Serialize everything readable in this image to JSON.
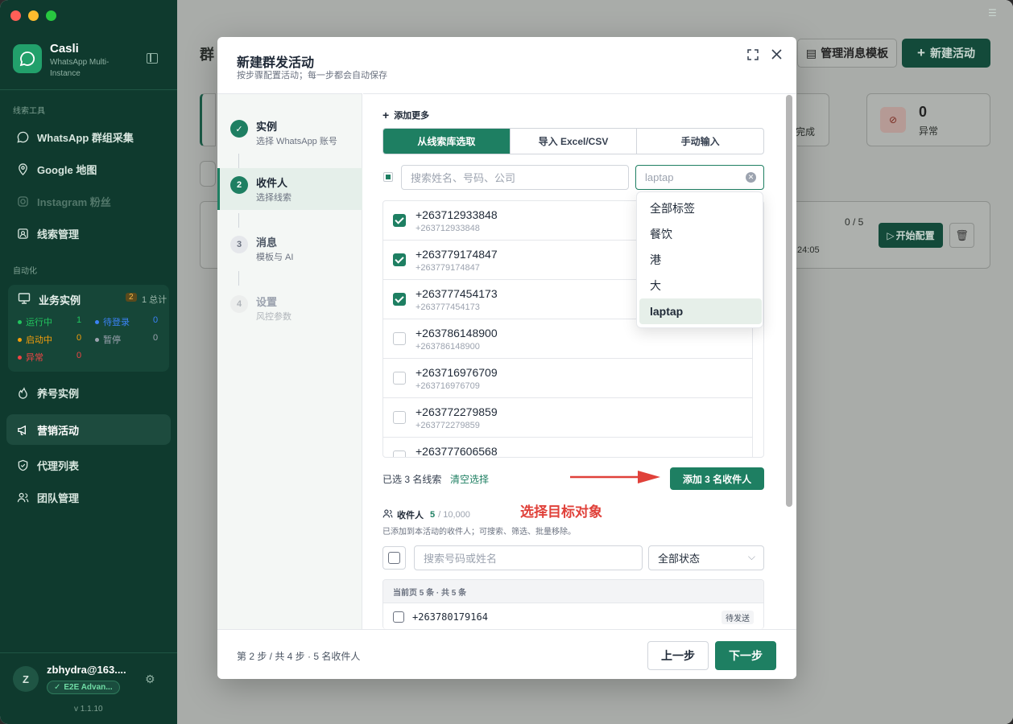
{
  "app": {
    "name": "Casli",
    "subtitle": "WhatsApp Multi-Instance",
    "version": "v 1.1.10"
  },
  "sidebar": {
    "section_tools": "线索工具",
    "section_auto": "自动化",
    "items": [
      {
        "label": "WhatsApp 群组采集",
        "icon": "chat-bubble-icon"
      },
      {
        "label": "Google 地图",
        "icon": "map-pin-icon"
      },
      {
        "label": "Instagram 粉丝",
        "icon": "instagram-icon"
      },
      {
        "label": "线索管理",
        "icon": "contact-card-icon"
      },
      {
        "label": "养号实例",
        "icon": "flame-icon"
      },
      {
        "label": "营销活动",
        "icon": "megaphone-icon"
      },
      {
        "label": "代理列表",
        "icon": "shield-icon"
      },
      {
        "label": "团队管理",
        "icon": "users-icon"
      }
    ],
    "business": {
      "title": "业务实例",
      "badge": "2",
      "total": "1 总计",
      "stats": [
        {
          "label": "运行中",
          "value": "1",
          "color": "#22c55e"
        },
        {
          "label": "待登录",
          "value": "0",
          "color": "#3b82f6"
        },
        {
          "label": "启动中",
          "value": "0",
          "color": "#f59e0b"
        },
        {
          "label": "暂停",
          "value": "0",
          "color": "#9ca3af"
        },
        {
          "label": "异常",
          "value": "0",
          "color": "#ef4444"
        }
      ]
    },
    "user": {
      "initial": "Z",
      "email": "zbhydra@163....",
      "plan": "E2E Advan..."
    }
  },
  "background": {
    "title_fragment": "群",
    "btn_templates": "管理消息模板",
    "btn_new": "新建活动",
    "stat_done": "完成",
    "stat_error_value": "0",
    "stat_error_label": "异常",
    "progress": "0 / 5",
    "time": ":24:05",
    "btn_start": "开始配置"
  },
  "modal": {
    "title": "新建群发活动",
    "subtitle": "按步骤配置活动；每一步都会自动保存",
    "steps": [
      {
        "num": "✓",
        "title": "实例",
        "sub": "选择 WhatsApp 账号"
      },
      {
        "num": "2",
        "title": "收件人",
        "sub": "选择线索"
      },
      {
        "num": "3",
        "title": "消息",
        "sub": "模板与 AI"
      },
      {
        "num": "4",
        "title": "设置",
        "sub": "风控参数"
      }
    ],
    "add_more": "添加更多",
    "tabs": [
      "从线索库选取",
      "导入 Excel/CSV",
      "手动输入"
    ],
    "search_placeholder": "搜索姓名、号码、公司",
    "tag_value": "laptap",
    "contacts": [
      {
        "phone": "+263712933848",
        "sub": "+263712933848",
        "checked": true
      },
      {
        "phone": "+263779174847",
        "sub": "+263779174847",
        "checked": true
      },
      {
        "phone": "+263777454173",
        "sub": "+263777454173",
        "checked": true
      },
      {
        "phone": "+263786148900",
        "sub": "+263786148900",
        "checked": false
      },
      {
        "phone": "+263716976709",
        "sub": "+263716976709",
        "checked": false
      },
      {
        "phone": "+263772279859",
        "sub": "+263772279859",
        "checked": false
      },
      {
        "phone": "+263777606568",
        "sub": "",
        "checked": false
      }
    ],
    "dropdown": [
      "全部标签",
      "餐饮",
      "港",
      "大",
      "laptap"
    ],
    "selected_text": "已选 3 名线索",
    "clear_text": "清空选择",
    "add_btn": "添加 3 名收件人",
    "annotation": "选择目标对象",
    "recipients": {
      "title": "收件人",
      "count": "5",
      "limit": "/ 10,000",
      "desc": "已添加到本活动的收件人；可搜索、筛选、批量移除。",
      "search_placeholder": "搜索号码或姓名",
      "status": "全部状态",
      "page_info": "当前页 5 条 · 共 5 条",
      "rows": [
        {
          "phone": "+263780179164",
          "status": "待发送"
        }
      ]
    },
    "footer_info": "第 2 步 / 共 4 步 · 5 名收件人",
    "prev": "上一步",
    "next": "下一步"
  }
}
